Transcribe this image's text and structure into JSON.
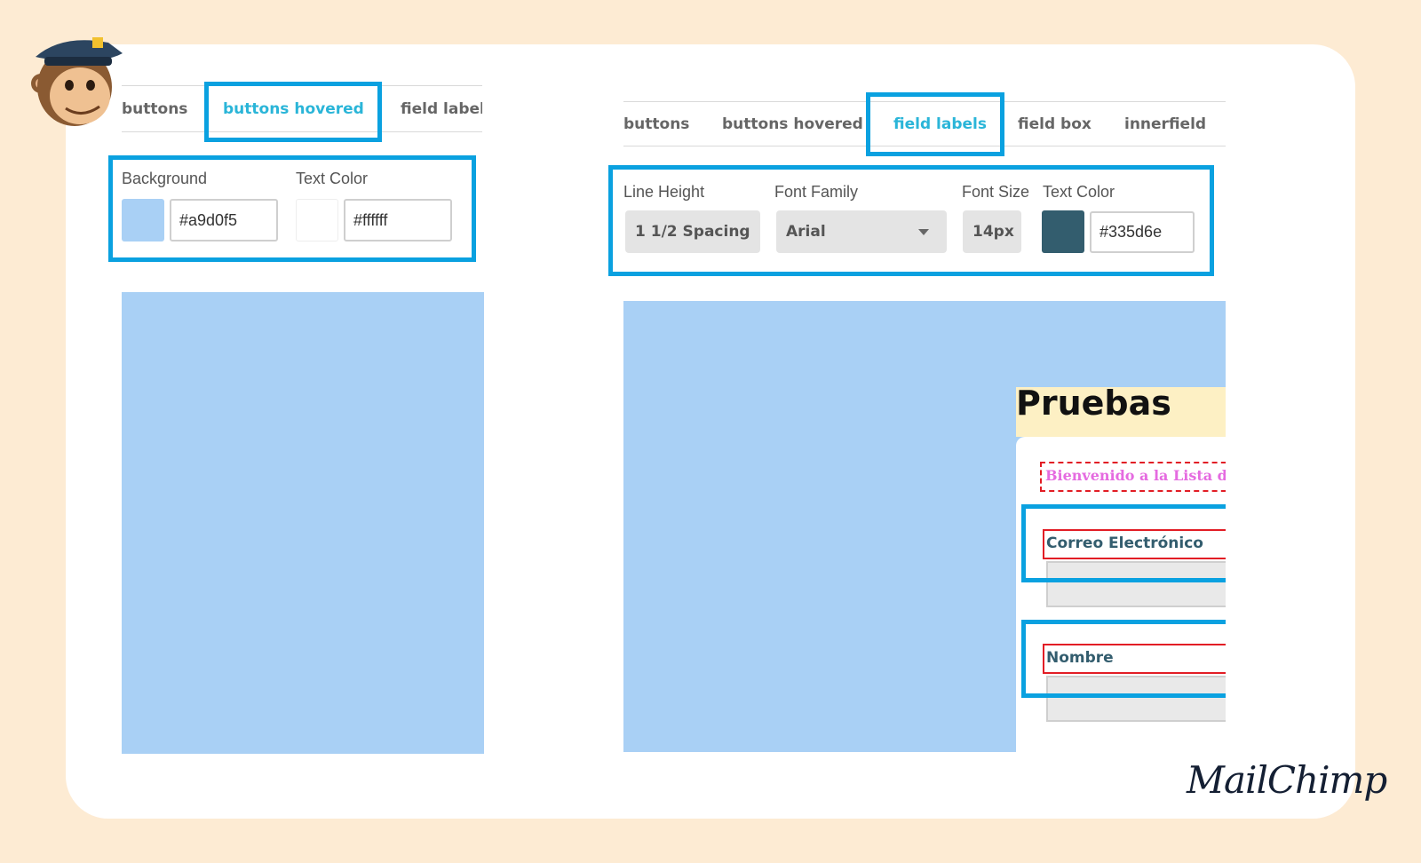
{
  "brand": {
    "logo_text": "MailChimp"
  },
  "left_panel": {
    "tabs": [
      "buttons",
      "buttons hovered",
      "field label"
    ],
    "active_tab": "buttons hovered",
    "settings": {
      "background_label": "Background",
      "background_value": "#a9d0f5",
      "background_swatch": "#a9d0f5",
      "text_color_label": "Text Color",
      "text_color_value": "#ffffff",
      "text_color_swatch": "#ffffff"
    }
  },
  "right_panel": {
    "tabs": [
      "buttons",
      "buttons hovered",
      "field labels",
      "field box",
      "innerfield"
    ],
    "active_tab": "field labels",
    "settings": {
      "line_height_label": "Line Height",
      "line_height_value": "1 1/2 Spacing",
      "font_family_label": "Font Family",
      "font_family_value": "Arial",
      "font_size_label": "Font Size",
      "font_size_value": "14px",
      "text_color_label": "Text Color",
      "text_color_value": "#335d6e",
      "text_color_swatch": "#335d6e"
    },
    "preview": {
      "title": "Pruebas",
      "welcome_text": "Bienvenido a la Lista de",
      "fields": [
        "Correo Electrónico",
        "Nombre"
      ]
    }
  },
  "colors": {
    "highlight": "#0aa1e0",
    "active_tab": "#2ab5d8",
    "preview_background": "#a9d0f5",
    "page_background": "#fdebd3"
  }
}
